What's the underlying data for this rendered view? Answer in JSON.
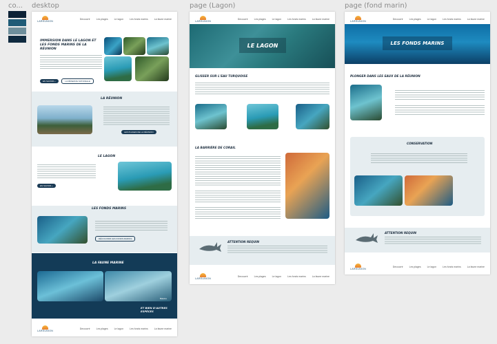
{
  "frames": {
    "colors_label": "co...",
    "desktop_label": "desktop",
    "lagon_label": "page (Lagon)",
    "fond_label": "page (fond marin)"
  },
  "palette": [
    "#0d2236",
    "#1f5b77",
    "#6e8f9c",
    "#0f2a3f"
  ],
  "nav": {
    "logo_text": "LAREUNION",
    "links": [
      "Decouvrir",
      "Les plages",
      "Le lagon",
      "Les fonds marins",
      "La faune marine"
    ]
  },
  "desktop": {
    "hero_title": "IMMERSION DANS LE LAGON ET LES FONDS MARINS DE LA RÉUNION",
    "hero_btn_primary": "EN SAVOIR +",
    "hero_btn_secondary": "LA RÉSERVE NATURELLE",
    "section_reunion_title": "LA RÉUNION",
    "section_reunion_btn": "LES PLAGES DE LA RÉUNION",
    "section_lagon_title": "LE LAGON",
    "section_lagon_btn": "EN SAVOIR +",
    "section_fonds_title": "LES FONDS MARINS",
    "section_fonds_btn": "DÉCOUVRIR LES FONDS MARINS",
    "section_faune_title": "LA FAUNE MARINE",
    "faune_caption": "Baleine",
    "faune_tagline": "ET BIEN D'AUTRES ESPÈCES"
  },
  "lagon_page": {
    "banner_title": "LE LAGON",
    "section1_title": "GLISSER SUR L'EAU TURQUOISE",
    "section2_title": "LA BARRIÈRE DE CORAIL",
    "warning_title": "ATTENTION REQUIN"
  },
  "fond_page": {
    "banner_title": "LES FONDS MARINS",
    "section1_title": "PLONGER DANS LES EAUX DE LA RÉUNION",
    "section2_title": "CONSERVATION",
    "warning_title": "ATTENTION REQUIN"
  }
}
